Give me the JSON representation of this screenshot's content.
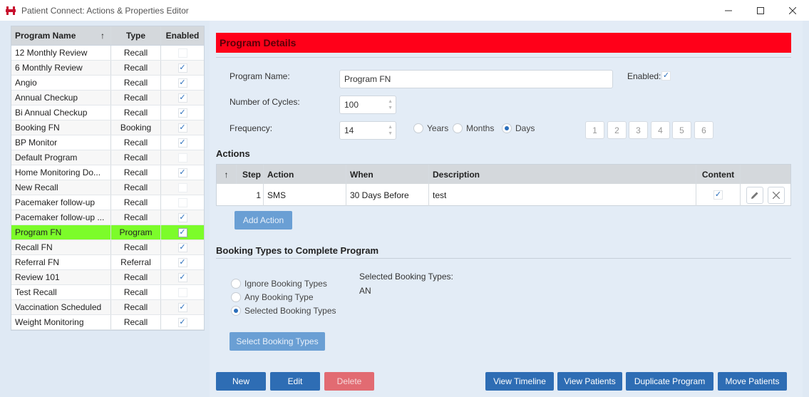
{
  "window": {
    "title": "Patient Connect: Actions & Properties Editor"
  },
  "programs": {
    "columns": {
      "name": "Program Name",
      "type": "Type",
      "enabled": "Enabled",
      "sort_glyph": "↑"
    },
    "rows": [
      {
        "name": "12 Monthly Review",
        "type": "Recall",
        "enabled": false
      },
      {
        "name": "6 Monthly Review",
        "type": "Recall",
        "enabled": true
      },
      {
        "name": "Angio",
        "type": "Recall",
        "enabled": true
      },
      {
        "name": "Annual Checkup",
        "type": "Recall",
        "enabled": true
      },
      {
        "name": "Bi Annual Checkup",
        "type": "Recall",
        "enabled": true
      },
      {
        "name": "Booking FN",
        "type": "Booking",
        "enabled": true
      },
      {
        "name": "BP Monitor",
        "type": "Recall",
        "enabled": true
      },
      {
        "name": "Default Program",
        "type": "Recall",
        "enabled": false
      },
      {
        "name": "Home Monitoring Do...",
        "type": "Recall",
        "enabled": true
      },
      {
        "name": "New Recall",
        "type": "Recall",
        "enabled": false
      },
      {
        "name": "Pacemaker follow-up",
        "type": "Recall",
        "enabled": false
      },
      {
        "name": "Pacemaker follow-up ...",
        "type": "Recall",
        "enabled": true
      },
      {
        "name": "Program FN",
        "type": "Program",
        "enabled": true,
        "selected": true
      },
      {
        "name": "Recall FN",
        "type": "Recall",
        "enabled": true
      },
      {
        "name": "Referral FN",
        "type": "Referral",
        "enabled": true
      },
      {
        "name": "Review 101",
        "type": "Recall",
        "enabled": true
      },
      {
        "name": "Test Recall",
        "type": "Recall",
        "enabled": false
      },
      {
        "name": "Vaccination Scheduled",
        "type": "Recall",
        "enabled": true
      },
      {
        "name": "Weight Monitoring",
        "type": "Recall",
        "enabled": true
      }
    ]
  },
  "details": {
    "header": "Program Details",
    "program_name_label": "Program Name:",
    "program_name_value": "Program FN",
    "enabled_label": "Enabled:",
    "enabled": true,
    "cycles_label": "Number of Cycles:",
    "cycles_value": "100",
    "frequency_label": "Frequency:",
    "frequency_value": "14",
    "frequency_units": [
      {
        "label": "Years",
        "selected": false
      },
      {
        "label": "Months",
        "selected": false
      },
      {
        "label": "Days",
        "selected": true
      }
    ],
    "number_buttons": [
      "1",
      "2",
      "3",
      "4",
      "5",
      "6"
    ]
  },
  "actions": {
    "title": "Actions",
    "columns": {
      "sort_glyph": "↑",
      "step": "Step",
      "action": "Action",
      "when": "When",
      "description": "Description",
      "content": "Content"
    },
    "rows": [
      {
        "step": "1",
        "action": "SMS",
        "when": "30 Days Before",
        "description": "test",
        "content": true
      }
    ],
    "add_label": "Add Action"
  },
  "booking": {
    "title": "Booking Types to Complete Program",
    "options": [
      {
        "label": "Ignore Booking Types",
        "selected": false
      },
      {
        "label": "Any Booking Type",
        "selected": false
      },
      {
        "label": "Selected Booking Types",
        "selected": true
      }
    ],
    "selected_label": "Selected Booking Types:",
    "selected_value": "AN",
    "select_button": "Select Booking Types"
  },
  "footer": {
    "new": "New",
    "edit": "Edit",
    "delete": "Delete",
    "view_timeline": "View Timeline",
    "view_patients": "View Patients",
    "duplicate": "Duplicate Program",
    "move": "Move Patients"
  }
}
